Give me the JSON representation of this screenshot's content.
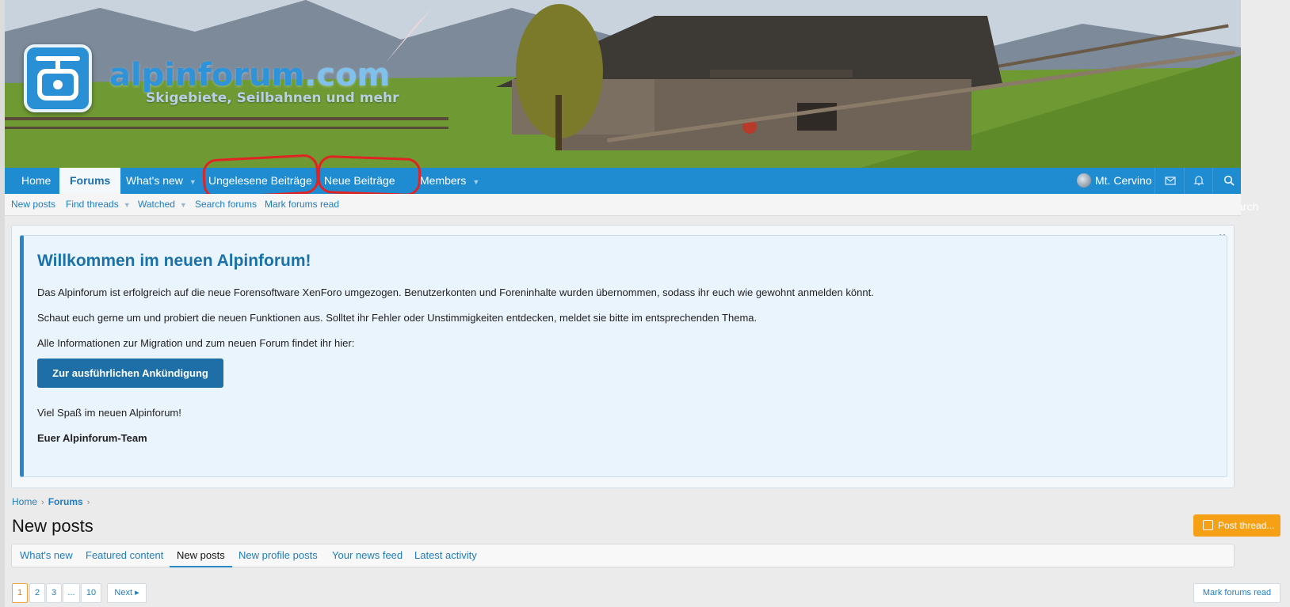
{
  "header": {
    "logo_main": "alpinforum",
    "logo_tld": ".com",
    "logo_tagline": "Skigebiete, Seilbahnen und mehr"
  },
  "nav": {
    "items": [
      {
        "label": "Home"
      },
      {
        "label": "Forums",
        "active": true
      },
      {
        "label": "What's new",
        "dropdown": true
      },
      {
        "label": "Ungelesene Beiträge"
      },
      {
        "label": "Neue Beiträge"
      },
      {
        "label": "Members",
        "dropdown": true
      }
    ],
    "user": "Mt. Cervino",
    "search": "Search",
    "highlight_color": "#e02424"
  },
  "subnav": {
    "items": [
      {
        "label": "New posts"
      },
      {
        "label": "Find threads",
        "dropdown": true
      },
      {
        "label": "Watched",
        "dropdown": true
      },
      {
        "label": "Search forums"
      },
      {
        "label": "Mark forums read"
      }
    ]
  },
  "notice": {
    "close": "×",
    "title": "Willkommen im neuen Alpinforum!",
    "p1": "Das Alpinforum ist erfolgreich auf die neue Forensoftware XenForo umgezogen. Benutzerkonten und Foreninhalte wurden übernommen, sodass ihr euch wie gewohnt anmelden könnt.",
    "p2": "Schaut euch gerne um und probiert die neuen Funktionen aus. Solltet ihr Fehler oder Unstimmigkeiten entdecken, meldet sie bitte im entsprechenden Thema.",
    "p3": "Alle Informationen zur Migration und zum neuen Forum findet ihr hier:",
    "button": "Zur ausführlichen Ankündigung",
    "p4": "Viel Spaß im neuen Alpinforum!",
    "signature": "Euer Alpinforum-Team"
  },
  "breadcrumb": {
    "home": "Home",
    "forums": "Forums"
  },
  "page": {
    "title": "New posts",
    "post_thread": "Post thread..."
  },
  "tabs": [
    {
      "label": "What's new"
    },
    {
      "label": "Featured content"
    },
    {
      "label": "New posts",
      "active": true
    },
    {
      "label": "New profile posts"
    },
    {
      "label": "Your news feed"
    },
    {
      "label": "Latest activity"
    }
  ],
  "pagination": {
    "pages": [
      "1",
      "2",
      "3",
      "...",
      "10"
    ],
    "current": "1",
    "next": "Next ▸",
    "mark_read": "Mark forums read"
  },
  "colors": {
    "nav_bg": "#1f8bd1",
    "accent": "#2a86c7",
    "post_button": "#f6a016"
  }
}
